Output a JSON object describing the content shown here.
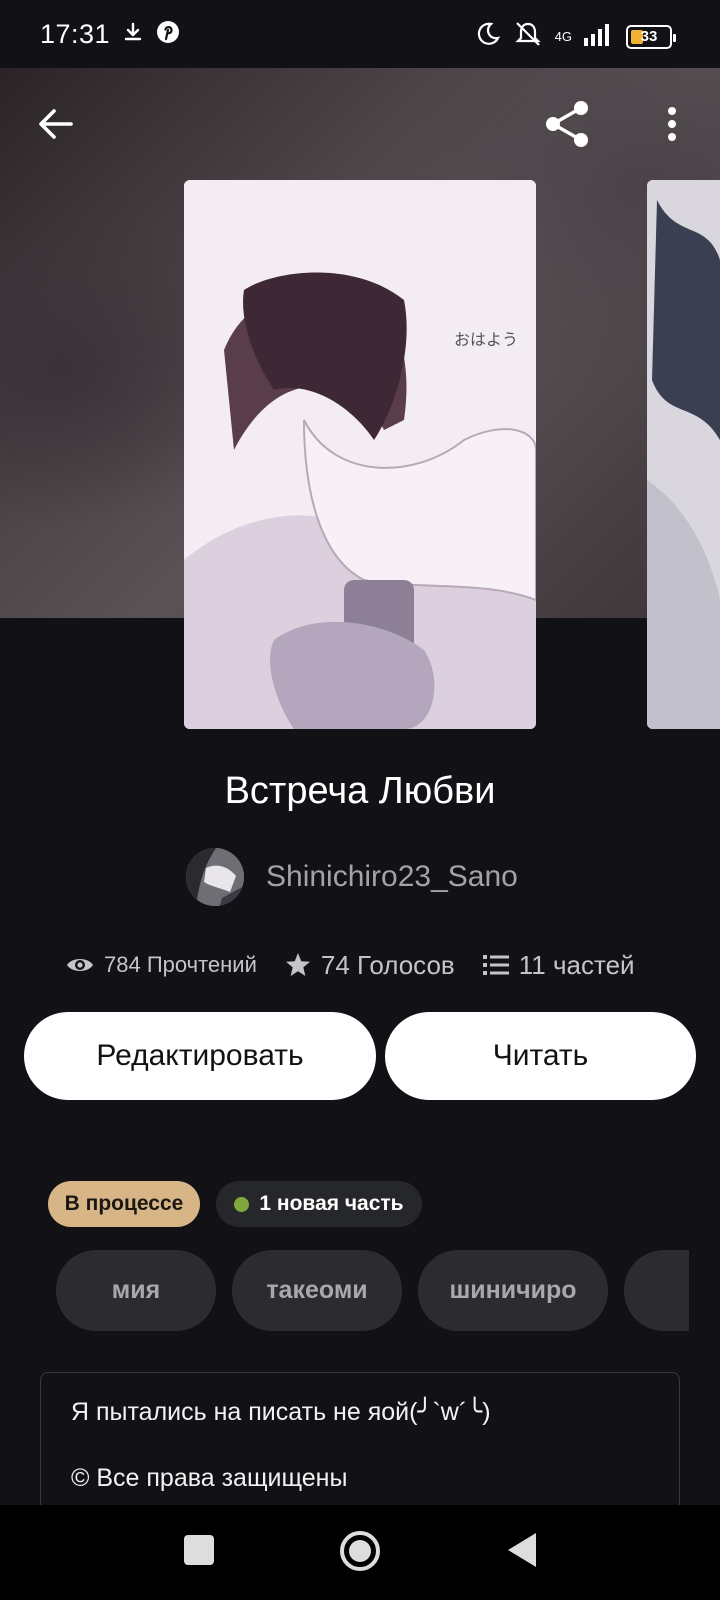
{
  "status_bar": {
    "time": "17:31",
    "network": "4G",
    "battery": "33"
  },
  "story": {
    "title": "Встреча Любви",
    "author": "Shinichiro23_Sano",
    "reads": "784 Прочтений",
    "votes": "74 Голосов",
    "parts": "11 частей"
  },
  "actions": {
    "edit_label": "Редактировать",
    "read_label": "Читать"
  },
  "badges": {
    "status": "В процессе",
    "new_part": "1 новая часть"
  },
  "tags": [
    "мия",
    "такеоми",
    "шиничиро"
  ],
  "description": {
    "line1": "Я пытались на писать не яой(╯`w´╰)",
    "line2": "© Все права защищены"
  },
  "colors": {
    "background": "#121115",
    "status_badge": "#d8b586",
    "new_part_dot": "#7fa93c",
    "tag_background": "#2c2c2f"
  }
}
